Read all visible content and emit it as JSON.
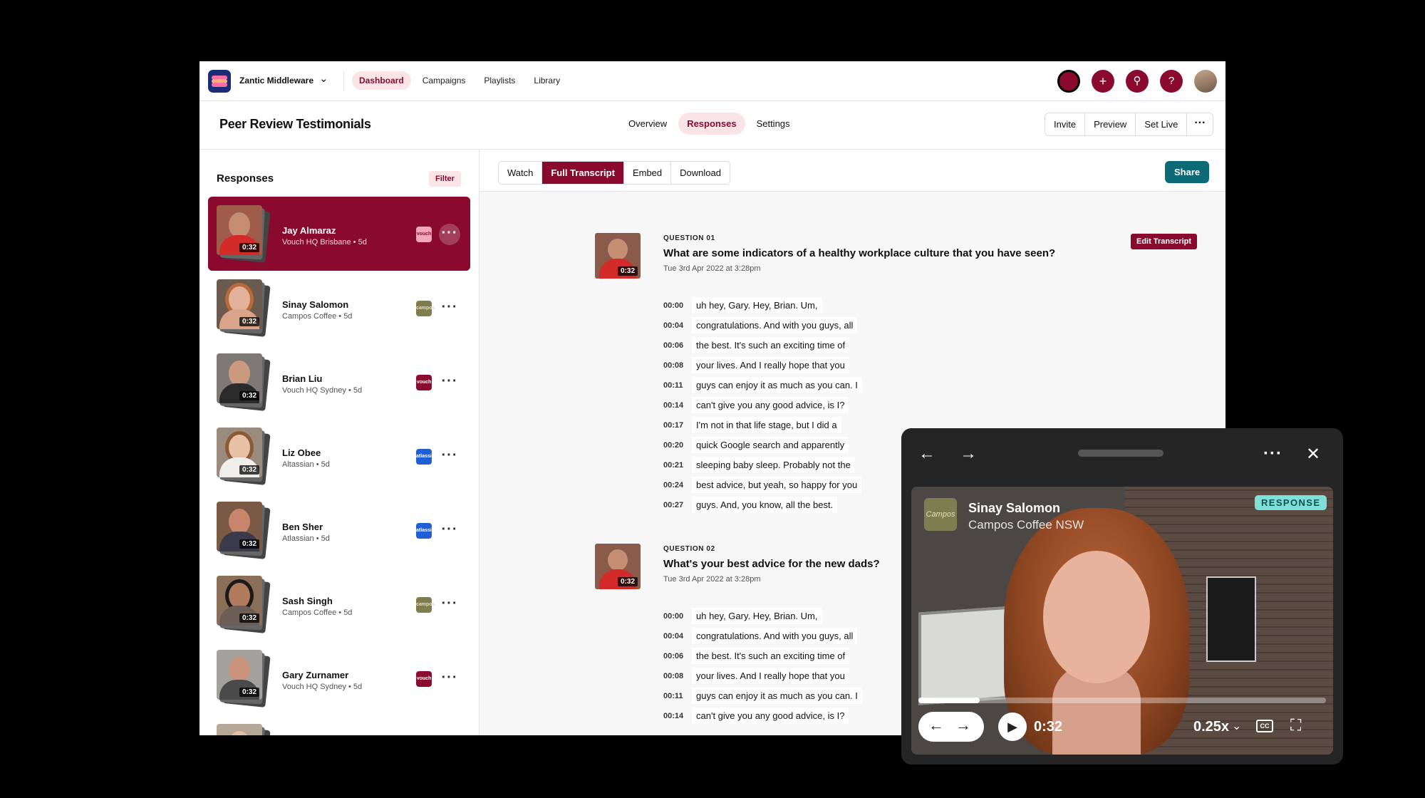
{
  "org": {
    "name": "Zantic Middleware"
  },
  "topnav": [
    {
      "label": "Dashboard",
      "active": true
    },
    {
      "label": "Campaigns",
      "active": false
    },
    {
      "label": "Playlists",
      "active": false
    },
    {
      "label": "Library",
      "active": false
    }
  ],
  "page": {
    "title": "Peer Review Testimonials"
  },
  "center_tabs": [
    {
      "label": "Overview",
      "active": false
    },
    {
      "label": "Responses",
      "active": true
    },
    {
      "label": "Settings",
      "active": false
    }
  ],
  "right_actions": {
    "invite": "Invite",
    "preview": "Preview",
    "set_live": "Set Live",
    "more": "···"
  },
  "sidebar": {
    "title": "Responses",
    "filter": "Filter",
    "items": [
      {
        "name": "Jay Almaraz",
        "org": "Vouch HQ Brisbane • 5d",
        "duration": "0:32",
        "brand": "vouch",
        "brand_color": "#f4a7b8",
        "active": true
      },
      {
        "name": "Sinay Salomon",
        "org": "Campos Coffee • 5d",
        "duration": "0:32",
        "brand": "campos",
        "brand_color": "#7d7d4f",
        "active": false
      },
      {
        "name": "Brian Liu",
        "org": "Vouch HQ Sydney • 5d",
        "duration": "0:32",
        "brand": "vouch",
        "brand_color": "#8a0a2e",
        "active": false
      },
      {
        "name": "Liz Obee",
        "org": "Altassian • 5d",
        "duration": "0:32",
        "brand": "atlassian",
        "brand_color": "#1f5fd6",
        "active": false
      },
      {
        "name": "Ben Sher",
        "org": "Atlassian • 5d",
        "duration": "0:32",
        "brand": "atlassian",
        "brand_color": "#1f5fd6",
        "active": false
      },
      {
        "name": "Sash Singh",
        "org": "Campos Coffee • 5d",
        "duration": "0:32",
        "brand": "campos",
        "brand_color": "#7d7d4f",
        "active": false
      },
      {
        "name": "Gary Zurnamer",
        "org": "Vouch HQ Sydney • 5d",
        "duration": "0:32",
        "brand": "vouch",
        "brand_color": "#8a0a2e",
        "active": false
      }
    ]
  },
  "subtabs": [
    {
      "label": "Watch",
      "active": false
    },
    {
      "label": "Full Transcript",
      "active": true
    },
    {
      "label": "Embed",
      "active": false
    },
    {
      "label": "Download",
      "active": false
    }
  ],
  "share_label": "Share",
  "edit_transcript": "Edit Transcript",
  "questions": [
    {
      "label": "QUESTION 01",
      "text": "What are some indicators of a healthy workplace culture that you have seen?",
      "date": "Tue 3rd Apr 2022 at 3:28pm",
      "duration": "0:32",
      "lines": [
        {
          "t": "00:00",
          "text": "uh hey, Gary. Hey, Brian. Um,"
        },
        {
          "t": "00:04",
          "text": "congratulations. And with you guys, all"
        },
        {
          "t": "00:06",
          "text": "the best. It's such an exciting time of"
        },
        {
          "t": "00:08",
          "text": "your lives. And I really hope that you"
        },
        {
          "t": "00:11",
          "text": "guys can enjoy it as much as you can. I"
        },
        {
          "t": "00:14",
          "text": "can't give you any good advice, is I?"
        },
        {
          "t": "00:17",
          "text": "I'm not in that life stage, but I did a"
        },
        {
          "t": "00:20",
          "text": "quick Google search and apparently"
        },
        {
          "t": "00:21",
          "text": "sleeping baby sleep. Probably not the"
        },
        {
          "t": "00:24",
          "text": "best advice, but yeah, so happy for you"
        },
        {
          "t": "00:27",
          "text": "guys. And, you know, all the best."
        }
      ]
    },
    {
      "label": "QUESTION 02",
      "text": "What's your best advice for the new dads?",
      "date": "Tue 3rd Apr 2022 at 3:28pm",
      "duration": "0:32",
      "lines": [
        {
          "t": "00:00",
          "text": "uh hey, Gary. Hey, Brian. Um,"
        },
        {
          "t": "00:04",
          "text": "congratulations. And with you guys, all"
        },
        {
          "t": "00:06",
          "text": "the best. It's such an exciting time of"
        },
        {
          "t": "00:08",
          "text": "your lives. And I really hope that you"
        },
        {
          "t": "00:11",
          "text": "guys can enjoy it as much as you can. I"
        },
        {
          "t": "00:14",
          "text": "can't give you any good advice, is I?"
        }
      ]
    }
  ],
  "player": {
    "name": "Sinay Salomon",
    "org": "Campos Coffee NSW",
    "badge": "RESPONSE",
    "logo_text": "Campos",
    "time": "0:32",
    "speed": "0.25x",
    "cc": "CC",
    "progress": 0.15
  },
  "colors": {
    "brand": "#8a0a2e",
    "brand_soft": "#fbe4e6",
    "share": "#0c6a77",
    "badge": "#7fe0d8"
  }
}
